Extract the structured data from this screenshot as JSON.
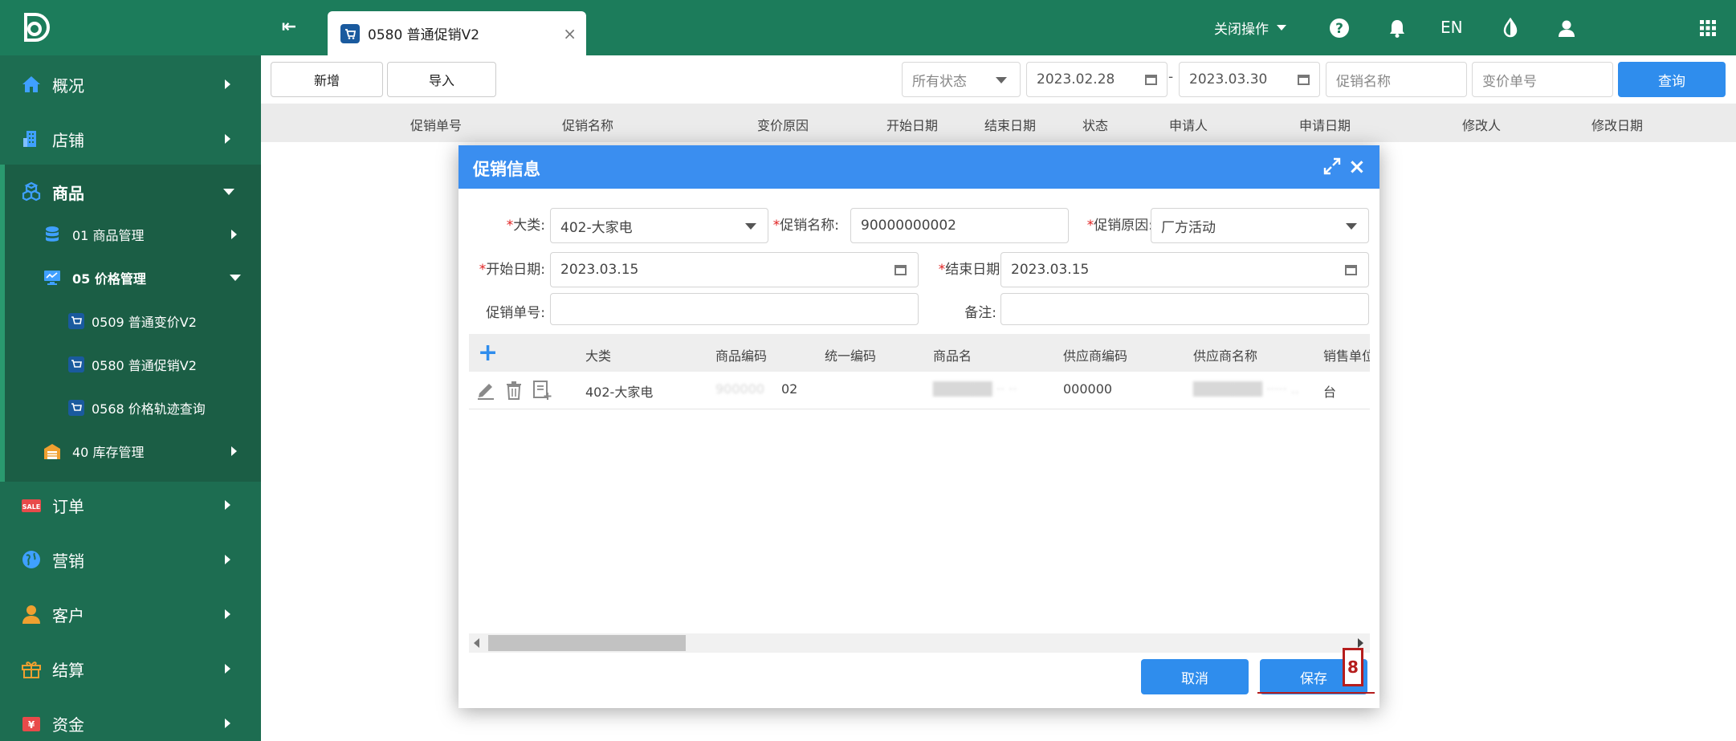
{
  "topbar": {
    "tab_label": "0580 普通促销V2",
    "close_ops": "关闭操作",
    "lang": "EN",
    "tab_close": "×",
    "collapse": "⇤"
  },
  "sidebar": {
    "items": [
      {
        "label": "概况"
      },
      {
        "label": "店铺"
      },
      {
        "label": "商品"
      },
      {
        "label": "订单"
      },
      {
        "label": "营销"
      },
      {
        "label": "客户"
      },
      {
        "label": "结算"
      },
      {
        "label": "资金"
      }
    ],
    "goods_sub": [
      {
        "label": "01 商品管理"
      },
      {
        "label": "05 价格管理"
      },
      {
        "label": "0509 普通变价V2"
      },
      {
        "label": "0580 普通促销V2"
      },
      {
        "label": "0568 价格轨迹查询"
      },
      {
        "label": "40 库存管理"
      }
    ]
  },
  "toolbar": {
    "add": "新增",
    "import": "导入",
    "status": "所有状态",
    "date_from": "2023.02.28",
    "date_sep": "-",
    "date_to": "2023.03.30",
    "promo_name_placeholder": "促销名称",
    "change_no_placeholder": "变价单号",
    "query": "查询"
  },
  "table": {
    "columns": [
      "促销单号",
      "促销名称",
      "变价原因",
      "开始日期",
      "结束日期",
      "状态",
      "申请人",
      "申请日期",
      "修改人",
      "修改日期"
    ]
  },
  "modal": {
    "title": "促销信息",
    "form": {
      "category_label": "大类:",
      "category_value": "402-大家电",
      "promo_name_label": "促销名称:",
      "promo_name_value": "90000000002",
      "promo_reason_label": "促销原因:",
      "promo_reason_value": "厂方活动",
      "start_label": "开始日期:",
      "start_value": "2023.03.15",
      "end_label": "结束日期:",
      "end_value": "2023.03.15",
      "promo_no_label": "促销单号:",
      "promo_no_value": "",
      "remark_label": "备注:",
      "remark_value": "",
      "req_mark": "*"
    },
    "grid": {
      "add": "+",
      "columns": [
        "大类",
        "商品编码",
        "统一编码",
        "商品名",
        "供应商编码",
        "供应商名称",
        "销售单位"
      ],
      "rows": [
        {
          "category": "402-大家电",
          "item_code_blurred": "900000",
          "item_code_tail": "02",
          "uniform_code": "",
          "item_name_blurred": "██████ ·· ·· ",
          "supplier_code": "000000",
          "supplier_name_blurred": "███████ ·····  ..",
          "unit": "台"
        }
      ]
    },
    "cancel": "取消",
    "save": "保存"
  },
  "annotation": {
    "step": "8"
  }
}
